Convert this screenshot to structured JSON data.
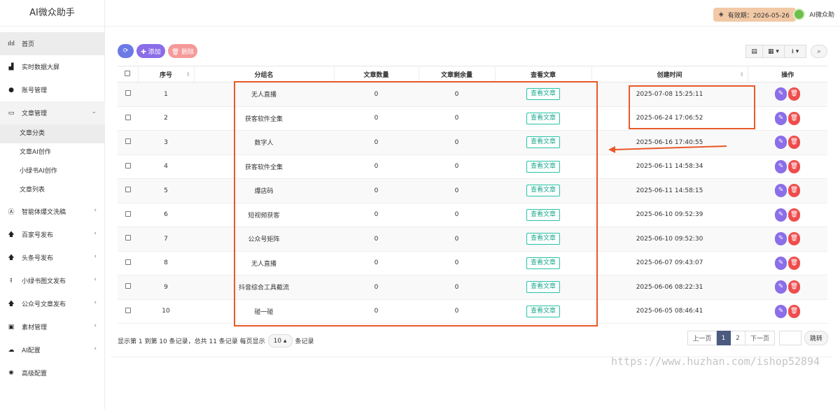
{
  "app": {
    "title": "AI微众助手"
  },
  "header": {
    "validity": "有效期：2026-05-26",
    "user_name": "AI微众助"
  },
  "sidebar": {
    "items": [
      {
        "label": "首页",
        "icon": "bar-chart-icon",
        "glyph": "ılıl",
        "state": "active"
      },
      {
        "label": "实时数据大屏",
        "icon": "area-chart-icon",
        "glyph": "▟"
      },
      {
        "label": "账号管理",
        "icon": "chat-bubbles-icon",
        "glyph": "●"
      },
      {
        "label": "文章管理",
        "icon": "folder-open-icon",
        "glyph": "▭",
        "state": "expanded",
        "arrow": "⌄"
      },
      {
        "label": "智能体爆文洗稿",
        "icon": "robot-icon",
        "glyph": "Ⓐ",
        "arrow": "‹"
      },
      {
        "label": "百家号发布",
        "icon": "arrow-up-icon",
        "glyph": "🡅",
        "arrow": "‹"
      },
      {
        "label": "头条号发布",
        "icon": "arrow-up-icon",
        "glyph": "🡅",
        "arrow": "‹"
      },
      {
        "label": "小绿书图文发布",
        "icon": "upload-icon",
        "glyph": "⭱",
        "arrow": "‹"
      },
      {
        "label": "公众号文章发布",
        "icon": "arrow-up-icon",
        "glyph": "🡅",
        "arrow": "‹"
      },
      {
        "label": "素材管理",
        "icon": "image-icon",
        "glyph": "▣",
        "arrow": "‹"
      },
      {
        "label": "AI配置",
        "icon": "cloud-icon",
        "glyph": "☁",
        "arrow": "‹"
      },
      {
        "label": "高级配置",
        "icon": "gear-icon",
        "glyph": "✺"
      }
    ],
    "sub_items": [
      {
        "label": "文章分类",
        "state": "active"
      },
      {
        "label": "文章AI创作"
      },
      {
        "label": "小绿书AI创作"
      },
      {
        "label": "文章列表"
      }
    ]
  },
  "toolbar": {
    "refresh_glyph": "⟳",
    "add_label": "✚ 添加",
    "delete_label": "🗑 删除",
    "view_toggle_glyph": "▤",
    "columns_glyph": "▦ ▾",
    "export_glyph": "⭳ ▾",
    "search_glyph": "⌕"
  },
  "table": {
    "columns": [
      "序号",
      "分组名",
      "文章数量",
      "文章剩余量",
      "查看文章",
      "创建时间",
      "操作"
    ],
    "view_label": "查看文章",
    "rows": [
      {
        "no": "1",
        "name": "无人直播",
        "count": "0",
        "remaining": "0",
        "created": "2025-07-08 15:25:11"
      },
      {
        "no": "2",
        "name": "获客软件全集",
        "count": "0",
        "remaining": "0",
        "created": "2025-06-24 17:06:52"
      },
      {
        "no": "3",
        "name": "数字人",
        "count": "0",
        "remaining": "0",
        "created": "2025-06-16 17:40:55"
      },
      {
        "no": "4",
        "name": "获客软件全集",
        "count": "0",
        "remaining": "0",
        "created": "2025-06-11 14:58:34"
      },
      {
        "no": "5",
        "name": "爆店码",
        "count": "0",
        "remaining": "0",
        "created": "2025-06-11 14:58:15"
      },
      {
        "no": "6",
        "name": "短视频获客",
        "count": "0",
        "remaining": "0",
        "created": "2025-06-10 09:52:39"
      },
      {
        "no": "7",
        "name": "公众号矩阵",
        "count": "0",
        "remaining": "0",
        "created": "2025-06-10 09:52:30"
      },
      {
        "no": "8",
        "name": "无人直播",
        "count": "0",
        "remaining": "0",
        "created": "2025-06-07 09:43:07"
      },
      {
        "no": "9",
        "name": "抖音综合工具截流",
        "count": "0",
        "remaining": "0",
        "created": "2025-06-06 08:22:31"
      },
      {
        "no": "10",
        "name": "碰一碰",
        "count": "0",
        "remaining": "0",
        "created": "2025-06-05 08:46:41"
      }
    ]
  },
  "footer": {
    "summary_prefix": "显示第 1 到第 10 条记录，总共 11 条记录 每页显示",
    "page_size": "10 ▴",
    "summary_suffix": "条记录",
    "prev": "上一页",
    "page1": "1",
    "page2": "2",
    "next": "下一页",
    "jump": "跳转"
  },
  "watermark": "https://www.huzhan.com/ishop52894"
}
